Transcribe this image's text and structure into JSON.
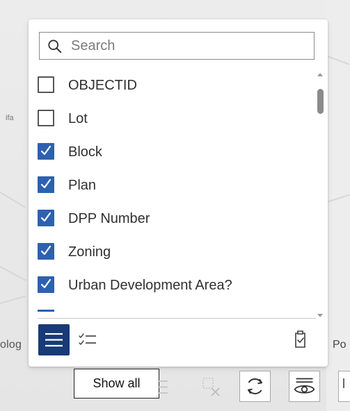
{
  "search": {
    "placeholder": "Search"
  },
  "fields": [
    {
      "label": "OBJECTID",
      "checked": false
    },
    {
      "label": "Lot",
      "checked": false
    },
    {
      "label": "Block",
      "checked": true
    },
    {
      "label": "Plan",
      "checked": true
    },
    {
      "label": "DPP Number",
      "checked": true
    },
    {
      "label": "Zoning",
      "checked": true
    },
    {
      "label": "Urban Development Area?",
      "checked": true
    }
  ],
  "tooltip": {
    "text": "Show all"
  },
  "map_labels": {
    "left_edge": "olog",
    "right_edge": "Po",
    "small_left": "ifa"
  },
  "colors": {
    "accent": "#2d61b0",
    "accent_dark": "#183a78"
  },
  "icons": {
    "search": "search-icon",
    "show_all": "list-icon",
    "show_selected": "checklist-icon",
    "clear_selection": "clipboard-check-icon",
    "refresh": "refresh-icon",
    "visibility": "eye-list-icon"
  }
}
